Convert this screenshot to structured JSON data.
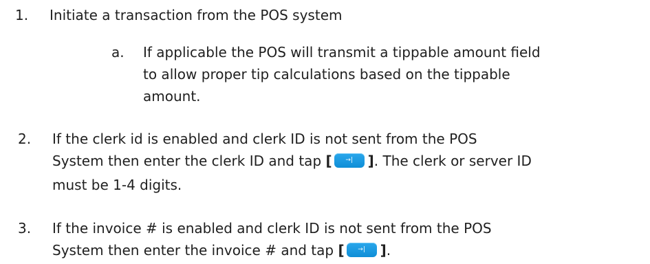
{
  "steps": [
    {
      "number": "1.",
      "lines": [
        "Initiate a transaction from the POS system"
      ]
    },
    {
      "number": "2.",
      "lines": [
        "If the clerk id is enabled and clerk ID is not sent from the POS",
        "System then enter the clerk ID and tap",
        ". The clerk or server ID",
        "must be 1-4 digits."
      ]
    },
    {
      "number": "3.",
      "lines": [
        "If the invoice # is enabled and clerk ID is not sent from the POS",
        "System then enter the invoice # and tap",
        "."
      ]
    }
  ],
  "substep": {
    "letter": "a.",
    "lines": [
      "If applicable the POS will transmit a tippable amount field",
      "to allow proper tip calculations based on the tippable",
      "amount."
    ]
  },
  "bracket_open": "[",
  "bracket_close": "]",
  "tab_button": {
    "glyph": "→|",
    "color": "#1a9be0",
    "icon": "tab-arrow-icon"
  }
}
